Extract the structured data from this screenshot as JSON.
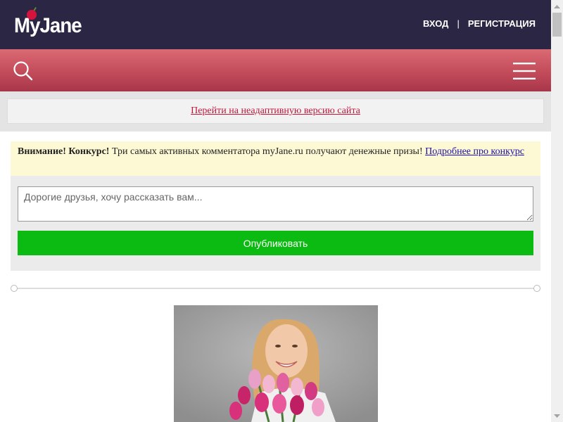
{
  "header": {
    "logo_text": "MyJane",
    "login_label": "ВХОД",
    "separator": "|",
    "register_label": "РЕГИСТРАЦИЯ"
  },
  "nav": {
    "search_icon": "search-icon",
    "menu_icon": "hamburger-menu-icon"
  },
  "nonadaptive": {
    "link_text": "Перейти на неадаптивную версию сайта"
  },
  "notice": {
    "bold_text": "Внимание! Конкурс!",
    "text": " Три самых активных комментатора myJane.ru получают денежные призы! ",
    "link_text": "Подробнее про конкурс"
  },
  "composer": {
    "placeholder": "Дорогие друзья, хочу рассказать вам...",
    "value": "",
    "publish_label": "Опубликовать"
  },
  "colors": {
    "header_bg": "#2c2645",
    "nav_gradient_top": "#da6a74",
    "nav_gradient_bottom": "#a8364a",
    "link_red": "#c0183c",
    "publish_green": "#0cbb12",
    "notice_bg": "#fdf9d4"
  }
}
